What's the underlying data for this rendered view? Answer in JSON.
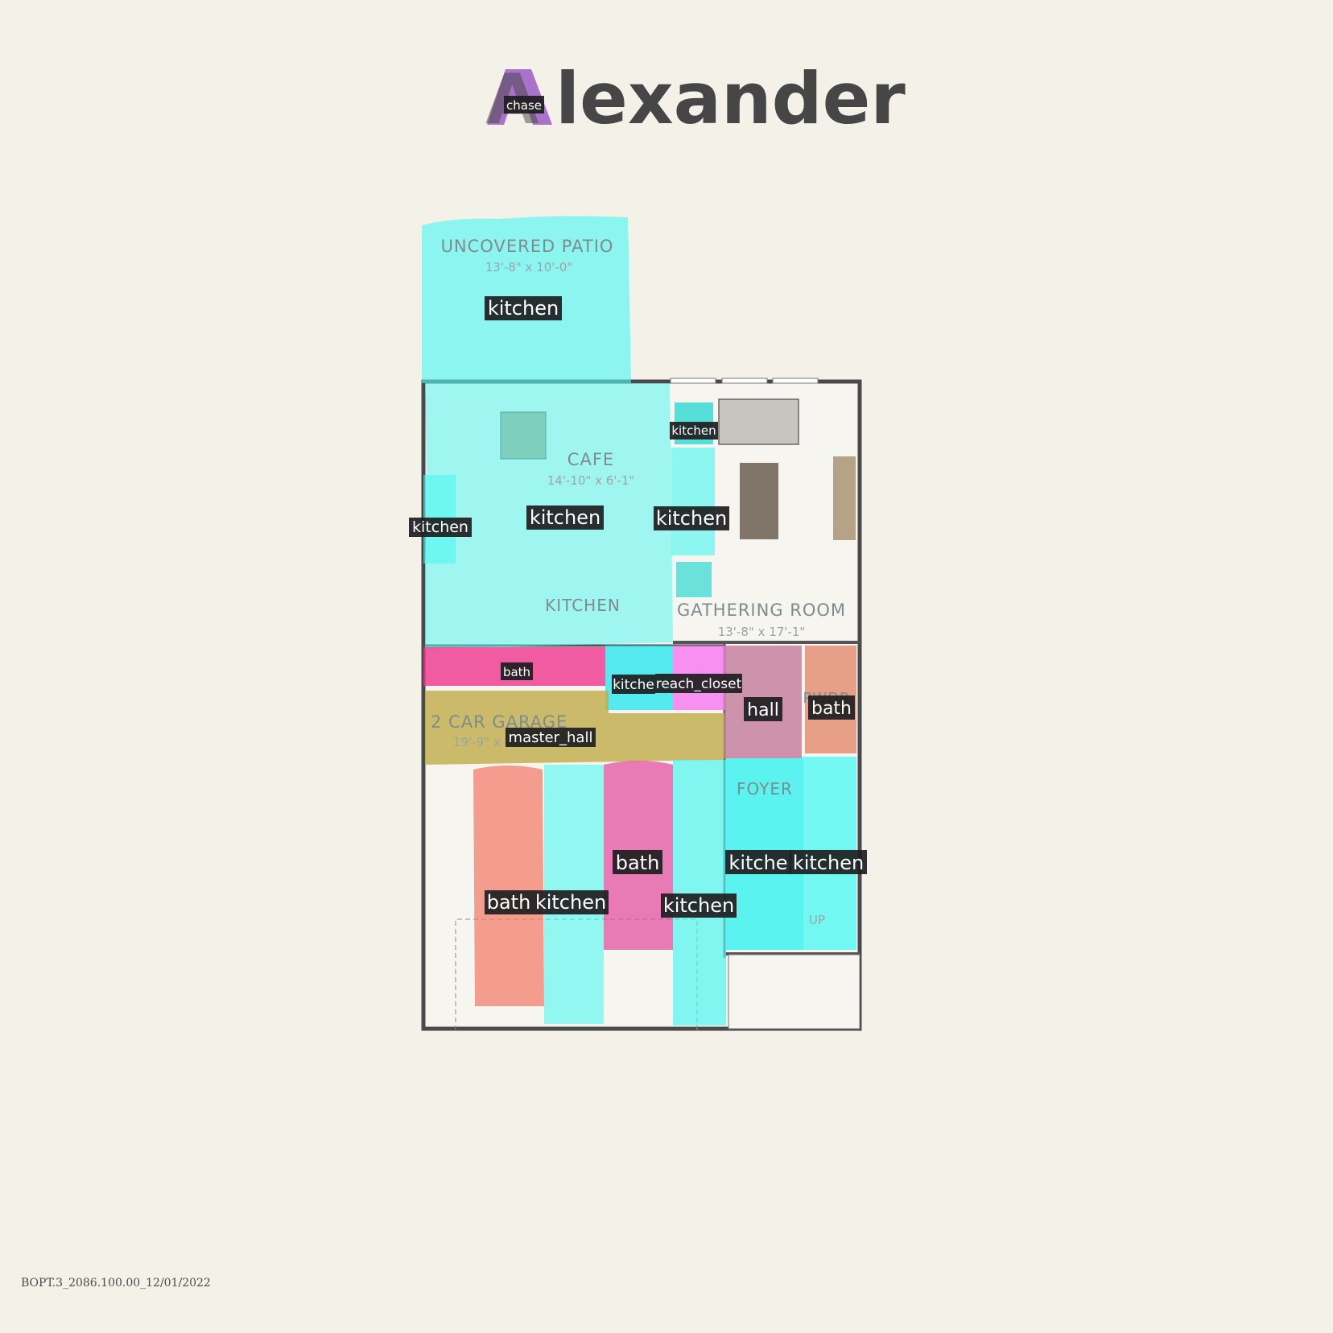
{
  "brand": {
    "wordmark_initial": "A",
    "wordmark_rest": "lexander",
    "initial_color": "#9b5cc6",
    "text_color": "#464646"
  },
  "rooms": {
    "patio_name": "UNCOVERED PATIO",
    "patio_dim": "13'-8\" x 10'-0\"",
    "cafe_name": "CAFE",
    "cafe_dim": "14'-10\" x 6'-1\"",
    "kitchen_name": "KITCHEN",
    "gathering_name": "GATHERING ROOM",
    "gathering_dim": "13'-8\" x 17'-1\"",
    "garage_name": "2 CAR GARAGE",
    "garage_dim": "19'-9\" x",
    "foyer_name": "FOYER",
    "pwdr_name": "PWDR",
    "stair_up": "UP"
  },
  "segmentation": {
    "colors": {
      "kitchen": "#4ef7f2",
      "bath_coral": "#f27b6a",
      "bath_pink": "#e24ba0",
      "bath_magenta": "#f0308c",
      "reach_closet": "#f77af0",
      "hall": "#c27b9c",
      "pwdr_bath": "#e38a6e",
      "master_hall": "#c2ad4e",
      "chase": "#b45ce0"
    },
    "tags": {
      "chase": "chase",
      "patio": "kitchen",
      "cafe": "kitchen",
      "small_top": "kitchen",
      "living_left": "kitchen",
      "counter_left": "kitchen",
      "counter_bath": "bath",
      "pantry": "kitche",
      "reach_closet": "reach_closet",
      "hall": "hall",
      "pwdr": "bath",
      "master_hall": "master_hall",
      "car1_bath": "bath",
      "car1_kitchen": "kitchen",
      "car2_bath": "bath",
      "car2_kitchen": "kitchen",
      "foyer_a": "kitche",
      "foyer_b": "kitchen"
    }
  },
  "footer": {
    "doc_code": "BOPT.3_2086.100.00_12/01/2022"
  }
}
